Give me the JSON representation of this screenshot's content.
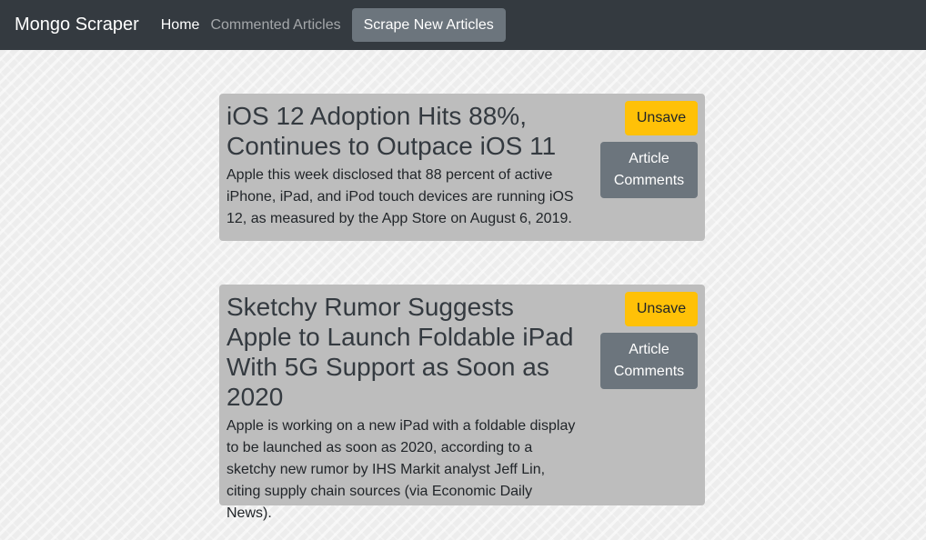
{
  "navbar": {
    "brand": "Mongo Scraper",
    "links": [
      {
        "label": "Home",
        "active": true
      },
      {
        "label": "Commented Articles",
        "active": false
      }
    ],
    "scrape_button": "Scrape New Articles"
  },
  "articles": [
    {
      "title": "iOS 12 Adoption Hits 88%, Continues to Outpace iOS 11",
      "summary": "Apple this week disclosed that 88 percent of active iPhone, iPad, and iPod touch devices are running iOS 12, as measured by the App Store on August 6, 2019.",
      "unsave_label": "Unsave",
      "comments_label": "Article Comments"
    },
    {
      "title": "Sketchy Rumor Suggests Apple to Launch Foldable iPad With 5G Support as Soon as 2020",
      "summary": "Apple is working on a new iPad with a foldable display to be launched as soon as 2020, according to a sketchy new rumor by IHS Markit analyst Jeff Lin, citing supply chain sources (via Economic Daily News).",
      "unsave_label": "Unsave",
      "comments_label": "Article Comments"
    }
  ],
  "colors": {
    "navbar": "#343a40",
    "card": "#bdbdbd",
    "unsave_button": "#ffc107",
    "secondary_button": "#6c757d"
  }
}
